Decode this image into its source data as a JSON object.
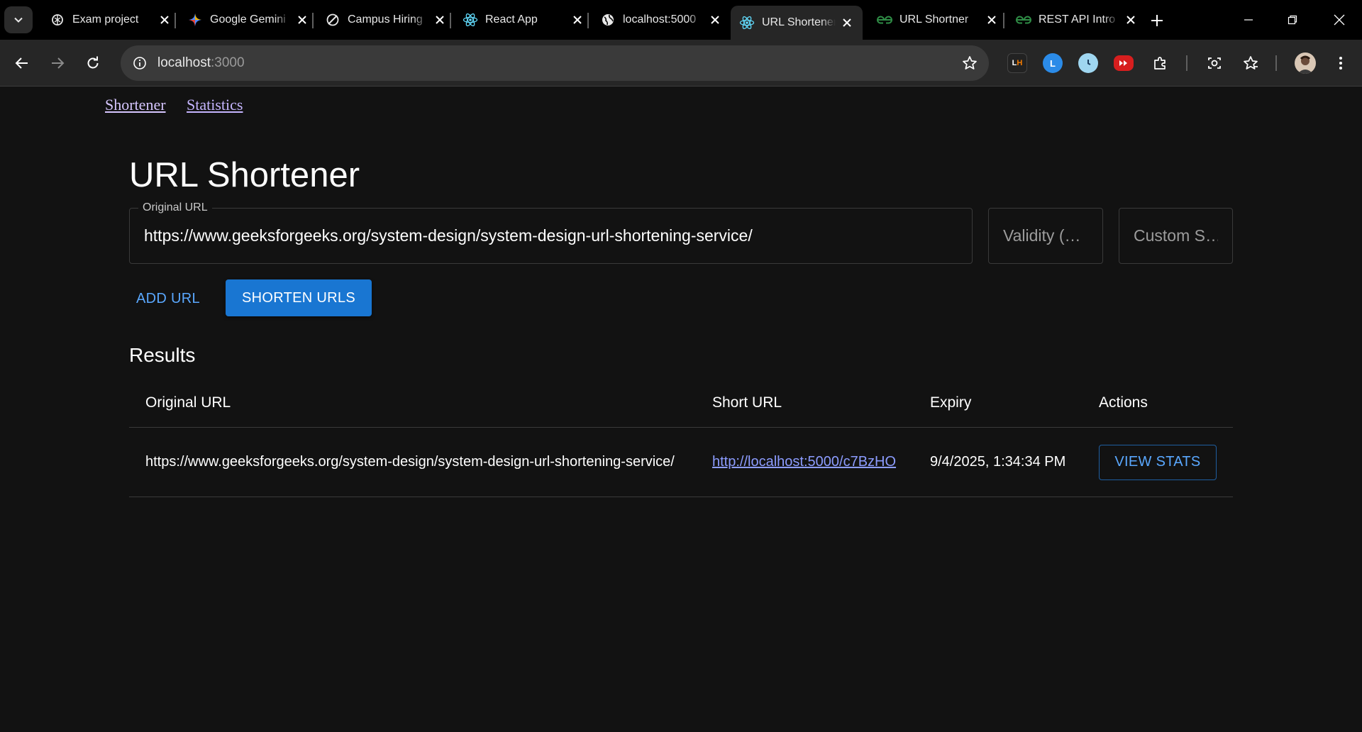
{
  "browser": {
    "tabs": [
      {
        "title": "Exam project",
        "icon": "openai-icon"
      },
      {
        "title": "Google Gemini",
        "icon": "gemini-icon"
      },
      {
        "title": "Campus Hiring",
        "icon": "campus-icon"
      },
      {
        "title": "React App",
        "icon": "react-icon"
      },
      {
        "title": "localhost:5000",
        "icon": "globe-icon"
      },
      {
        "title": "URL Shortener",
        "icon": "react-icon",
        "active": true
      },
      {
        "title": "URL Shortner",
        "icon": "gfg-icon"
      },
      {
        "title": "REST API Intro",
        "icon": "gfg-icon"
      }
    ],
    "address": {
      "host": "localhost",
      "port": ":3000"
    },
    "extensions": [
      "LH",
      "L",
      "clock",
      "yt"
    ],
    "accent": "#1976d2"
  },
  "page": {
    "nav": {
      "shortener": "Shortener",
      "statistics": "Statistics"
    },
    "title": "URL Shortener",
    "form": {
      "original_url_label": "Original URL",
      "original_url_value": "https://www.geeksforgeeks.org/system-design/system-design-url-shortening-service/",
      "validity_placeholder": "Validity (…",
      "custom_placeholder": "Custom S…"
    },
    "buttons": {
      "add_url": "ADD URL",
      "shorten": "SHORTEN URLS"
    },
    "results": {
      "heading": "Results",
      "columns": [
        "Original URL",
        "Short URL",
        "Expiry",
        "Actions"
      ],
      "rows": [
        {
          "original": "https://www.geeksforgeeks.org/system-design/system-design-url-shortening-service/",
          "short": "http://localhost:5000/c7BzHO",
          "expiry": "9/4/2025, 1:34:34 PM",
          "action": "VIEW STATS"
        }
      ]
    }
  }
}
